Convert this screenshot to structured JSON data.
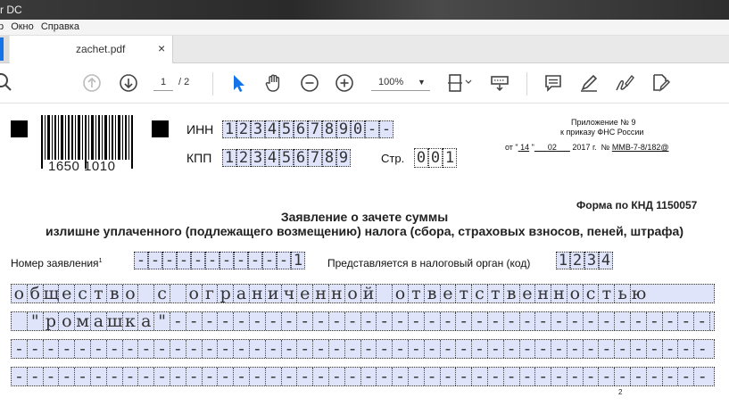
{
  "window": {
    "title_fragment": "r DC"
  },
  "menu": {
    "items": [
      "р",
      "Окно",
      "Справка"
    ]
  },
  "tab": {
    "filename": "zachet.pdf",
    "close": "×"
  },
  "toolbar": {
    "page_current": "1",
    "page_total": "/ 2",
    "zoom": "100%",
    "zoom_arrow": "▼"
  },
  "doc": {
    "barcode_number": "1650 1010",
    "inn_label": "ИНН",
    "inn_cells": [
      "1",
      "2",
      "3",
      "4",
      "5",
      "6",
      "7",
      "8",
      "9",
      "0",
      "-",
      "-"
    ],
    "kpp_label": "КПП",
    "kpp_cells": [
      "1",
      "2",
      "3",
      "4",
      "5",
      "6",
      "7",
      "8",
      "9"
    ],
    "page_label": "Стр.",
    "page_cells": [
      "0",
      "0",
      "1"
    ],
    "appendix_line1": "Приложение № 9",
    "appendix_line2": "к приказу ФНС России",
    "order_date_prefix": "от \"",
    "order_day": "14",
    "order_quote": " \"",
    "order_month": "02",
    "order_year": "2017 г.",
    "order_num_label": "№",
    "order_num": "ММВ-7-8/182@",
    "form_code": "Форма по КНД 1150057",
    "heading1": "Заявление о зачете суммы",
    "heading2": "излишне уплаченного (подлежащего возмещению) налога (сбора, страховых взносов, пеней, штрафа)",
    "app_number_label": "Номер заявления",
    "app_number_sup": "1",
    "app_number_cells": [
      "-",
      "-",
      "-",
      "-",
      "-",
      "-",
      "-",
      "-",
      "-",
      "-",
      "-",
      "1"
    ],
    "tax_org_label": "Представляется в налоговый орган (код)",
    "tax_org_cells": [
      "1",
      "2",
      "3",
      "4"
    ],
    "name_row1": "общество с ограниченной ответственностью",
    "name_row2": " \"ромашка\"-----------------------------------",
    "name_row3": "--------------------------------------------",
    "name_row4": "--------------------------------------------",
    "footnote_sup": "2"
  }
}
